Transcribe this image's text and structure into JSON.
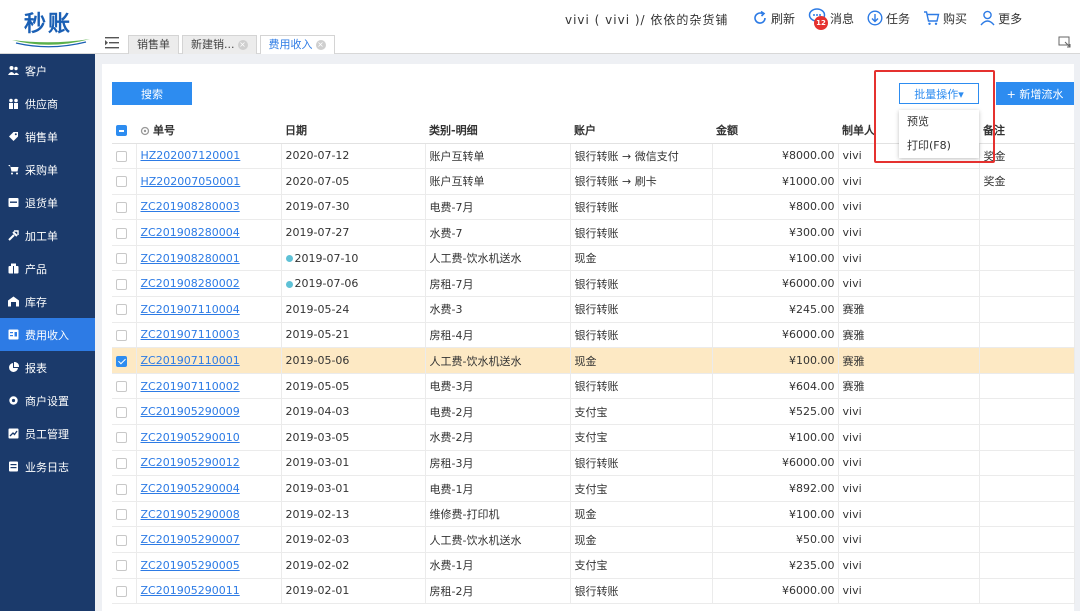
{
  "header": {
    "logo_text": "秒账",
    "user_line": "vivi ( vivi )/ 依依的杂货铺",
    "actions": {
      "refresh": "刷新",
      "messages": "消息",
      "message_count": "12",
      "tasks": "任务",
      "purchase": "购买",
      "more": "更多"
    },
    "tabs": [
      {
        "label": "销售单"
      },
      {
        "label": "新建销..."
      },
      {
        "label": "费用收入"
      }
    ]
  },
  "sidebar": {
    "items": [
      {
        "label": "客户"
      },
      {
        "label": "供应商"
      },
      {
        "label": "销售单"
      },
      {
        "label": "采购单"
      },
      {
        "label": "退货单"
      },
      {
        "label": "加工单"
      },
      {
        "label": "产品"
      },
      {
        "label": "库存"
      },
      {
        "label": "费用收入"
      },
      {
        "label": "报表"
      },
      {
        "label": "商户设置"
      },
      {
        "label": "员工管理"
      },
      {
        "label": "业务日志"
      }
    ]
  },
  "toolbar": {
    "search_label": "搜索",
    "batch_label": "批量操作▾",
    "add_label": "+ 新增流水",
    "dropdown": [
      {
        "label": "预览"
      },
      {
        "label": "打印(F8)"
      }
    ]
  },
  "table": {
    "headers": {
      "order_no": "单号",
      "date": "日期",
      "category": "类别-明细",
      "account": "账户",
      "amount": "金额",
      "creator": "制单人",
      "note": "备注"
    },
    "rows": [
      {
        "order_no": "HZ202007120001",
        "date": "2020-07-12",
        "category": "账户互转单",
        "account": "银行转账 → 微信支付",
        "amount": "¥8000.00",
        "creator": "vivi",
        "note": "奖金"
      },
      {
        "order_no": "HZ202007050001",
        "date": "2020-07-05",
        "category": "账户互转单",
        "account": "银行转账 → 刷卡",
        "amount": "¥1000.00",
        "creator": "vivi",
        "note": "奖金"
      },
      {
        "order_no": "ZC201908280003",
        "date": "2019-07-30",
        "category": "电费-7月",
        "account": "银行转账",
        "amount": "¥800.00",
        "creator": "vivi",
        "note": ""
      },
      {
        "order_no": "ZC201908280004",
        "date": "2019-07-27",
        "category": "水费-7",
        "account": "银行转账",
        "amount": "¥300.00",
        "creator": "vivi",
        "note": ""
      },
      {
        "order_no": "ZC201908280001",
        "date": "2019-07-10",
        "category": "人工费-饮水机送水",
        "account": "现金",
        "amount": "¥100.00",
        "creator": "vivi",
        "note": ""
      },
      {
        "order_no": "ZC201908280002",
        "date": "2019-07-06",
        "category": "房租-7月",
        "account": "银行转账",
        "amount": "¥6000.00",
        "creator": "vivi",
        "note": ""
      },
      {
        "order_no": "ZC201907110004",
        "date": "2019-05-24",
        "category": "水费-3",
        "account": "银行转账",
        "amount": "¥245.00",
        "creator": "赛雅",
        "note": ""
      },
      {
        "order_no": "ZC201907110003",
        "date": "2019-05-21",
        "category": "房租-4月",
        "account": "银行转账",
        "amount": "¥6000.00",
        "creator": "赛雅",
        "note": ""
      },
      {
        "order_no": "ZC201907110001",
        "date": "2019-05-06",
        "category": "人工费-饮水机送水",
        "account": "现金",
        "amount": "¥100.00",
        "creator": "赛雅",
        "note": ""
      },
      {
        "order_no": "ZC201907110002",
        "date": "2019-05-05",
        "category": "电费-3月",
        "account": "银行转账",
        "amount": "¥604.00",
        "creator": "赛雅",
        "note": ""
      },
      {
        "order_no": "ZC201905290009",
        "date": "2019-04-03",
        "category": "电费-2月",
        "account": "支付宝",
        "amount": "¥525.00",
        "creator": "vivi",
        "note": ""
      },
      {
        "order_no": "ZC201905290010",
        "date": "2019-03-05",
        "category": "水费-2月",
        "account": "支付宝",
        "amount": "¥100.00",
        "creator": "vivi",
        "note": ""
      },
      {
        "order_no": "ZC201905290012",
        "date": "2019-03-01",
        "category": "房租-3月",
        "account": "银行转账",
        "amount": "¥6000.00",
        "creator": "vivi",
        "note": ""
      },
      {
        "order_no": "ZC201905290004",
        "date": "2019-03-01",
        "category": "电费-1月",
        "account": "支付宝",
        "amount": "¥892.00",
        "creator": "vivi",
        "note": ""
      },
      {
        "order_no": "ZC201905290008",
        "date": "2019-02-13",
        "category": "维修费-打印机",
        "account": "现金",
        "amount": "¥100.00",
        "creator": "vivi",
        "note": ""
      },
      {
        "order_no": "ZC201905290007",
        "date": "2019-02-03",
        "category": "人工费-饮水机送水",
        "account": "现金",
        "amount": "¥50.00",
        "creator": "vivi",
        "note": ""
      },
      {
        "order_no": "ZC201905290005",
        "date": "2019-02-02",
        "category": "水费-1月",
        "account": "支付宝",
        "amount": "¥235.00",
        "creator": "vivi",
        "note": ""
      },
      {
        "order_no": "ZC201905290011",
        "date": "2019-02-01",
        "category": "房租-2月",
        "account": "银行转账",
        "amount": "¥6000.00",
        "creator": "vivi",
        "note": ""
      }
    ]
  },
  "colors": {
    "sidebar_bg": "#1b3a6b",
    "accent": "#2d8cf0",
    "highlight_row": "#fde9c4",
    "callout": "#e5312f"
  }
}
